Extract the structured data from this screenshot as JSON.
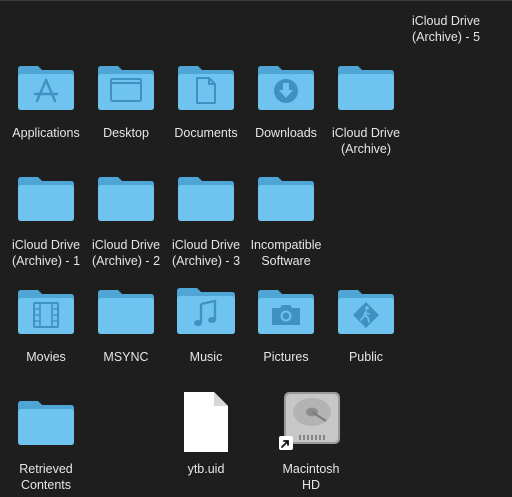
{
  "colors": {
    "background": "#1e1e1e",
    "folder_back": "#4fa6d6",
    "folder_front": "#6ec4ee",
    "folder_glyph": "#3f91c2",
    "label_text": "#e6e6e6"
  },
  "items": [
    {
      "label": "Applications",
      "icon": "applications-folder-icon"
    },
    {
      "label": "Desktop",
      "icon": "desktop-folder-icon"
    },
    {
      "label": "Documents",
      "icon": "documents-folder-icon"
    },
    {
      "label": "Downloads",
      "icon": "downloads-folder-icon"
    },
    {
      "label": "iCloud Drive\n(Archive)",
      "icon": "folder-icon"
    },
    {
      "label": "iCloud Drive\n(Archive) - 5",
      "icon": "folder-icon"
    },
    {
      "label": "iCloud Drive\n(Archive) - 1",
      "icon": "folder-icon"
    },
    {
      "label": "iCloud Drive\n(Archive) - 2",
      "icon": "folder-icon"
    },
    {
      "label": "iCloud Drive\n(Archive) - 3",
      "icon": "folder-icon"
    },
    {
      "label": "Incompatible\nSoftware",
      "icon": "folder-icon"
    },
    {
      "label": "Movies",
      "icon": "movies-folder-icon"
    },
    {
      "label": "MSYNC",
      "icon": "folder-icon"
    },
    {
      "label": "Music",
      "icon": "music-folder-icon"
    },
    {
      "label": "Pictures",
      "icon": "pictures-folder-icon"
    },
    {
      "label": "Public",
      "icon": "public-folder-icon"
    },
    {
      "label": "Retrieved\nContents",
      "icon": "folder-icon"
    },
    {
      "label": "ytb.uid",
      "icon": "document-file-icon"
    },
    {
      "label": "Macintosh\nHD",
      "icon": "hard-drive-alias-icon"
    }
  ]
}
